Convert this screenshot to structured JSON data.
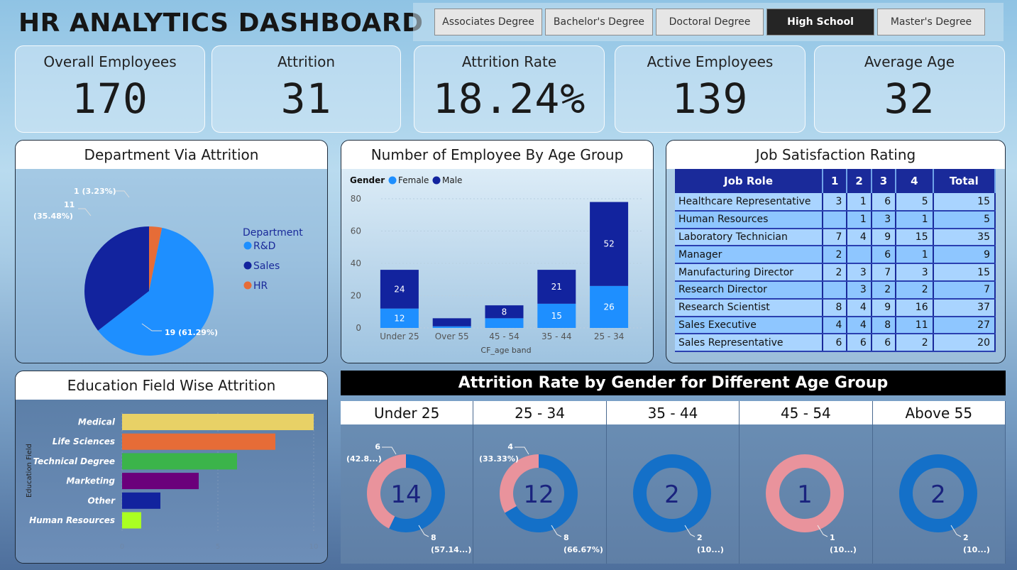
{
  "header": {
    "title": "HR ANALYTICS DASHBOARD"
  },
  "slicer": {
    "options": [
      "Associates Degree",
      "Bachelor's Degree",
      "Doctoral Degree",
      "High School",
      "Master's Degree"
    ],
    "selected": "High School"
  },
  "kpis": [
    {
      "label": "Overall Employees",
      "value": "170"
    },
    {
      "label": "Attrition",
      "value": "31"
    },
    {
      "label": "Attrition Rate",
      "value": "18.24%"
    },
    {
      "label": "Active Employees",
      "value": "139"
    },
    {
      "label": "Average Age",
      "value": "32"
    }
  ],
  "department_panel": {
    "title": "Department Via Attrition"
  },
  "age_panel": {
    "title": "Number of Employee By Age Group"
  },
  "job_panel": {
    "title": "Job Satisfaction Rating"
  },
  "edu_panel": {
    "title": "Education Field Wise Attrition"
  },
  "gender_panel": {
    "title": "Attrition Rate by Gender for Different Age Group"
  },
  "colors": {
    "rd": "#1e8fff",
    "sales": "#12239e",
    "hr": "#e66c37",
    "female": "#1e8fff",
    "male": "#12239e",
    "donut_blue": "#1470c8",
    "donut_pink": "#e9939c"
  },
  "chart_data": [
    {
      "type": "pie",
      "title": "Department Via Attrition",
      "legend_title": "Department",
      "legend_position": "right",
      "categories": [
        "R&D",
        "Sales",
        "HR"
      ],
      "values": [
        19,
        11,
        1
      ],
      "labels": [
        "19 (61.29%)",
        "11 (35.48%)",
        "1 (3.23%)"
      ]
    },
    {
      "type": "bar",
      "stacked": true,
      "title": "Number of Employee By Age Group",
      "legend_title": "Gender",
      "legend_position": "top-left",
      "xlabel": "CF_age band",
      "ylabel": "",
      "categories": [
        "Under 25",
        "Over 55",
        "45 - 54",
        "35 - 44",
        "25 - 34"
      ],
      "ylim": [
        0,
        80
      ],
      "yticks": [
        0,
        20,
        40,
        60,
        80
      ],
      "series": [
        {
          "name": "Female",
          "values": [
            12,
            1,
            6,
            15,
            26
          ],
          "labels": [
            "12",
            "",
            "",
            "15",
            "26"
          ]
        },
        {
          "name": "Male",
          "values": [
            24,
            5,
            8,
            21,
            52
          ],
          "labels": [
            "24",
            "",
            "8",
            "21",
            "52"
          ]
        }
      ]
    },
    {
      "type": "table",
      "title": "Job Satisfaction Rating",
      "columns": [
        "Job Role",
        "1",
        "2",
        "3",
        "4",
        "Total"
      ],
      "rows": [
        [
          "Healthcare Representative",
          "3",
          "1",
          "6",
          "5",
          "15"
        ],
        [
          "Human Resources",
          "",
          "1",
          "3",
          "1",
          "5"
        ],
        [
          "Laboratory Technician",
          "7",
          "4",
          "9",
          "15",
          "35"
        ],
        [
          "Manager",
          "2",
          "",
          "6",
          "1",
          "9"
        ],
        [
          "Manufacturing Director",
          "2",
          "3",
          "7",
          "3",
          "15"
        ],
        [
          "Research Director",
          "",
          "3",
          "2",
          "2",
          "7"
        ],
        [
          "Research Scientist",
          "8",
          "4",
          "9",
          "16",
          "37"
        ],
        [
          "Sales Executive",
          "4",
          "4",
          "8",
          "11",
          "27"
        ],
        [
          "Sales Representative",
          "6",
          "6",
          "6",
          "2",
          "20"
        ]
      ]
    },
    {
      "type": "bar",
      "orientation": "horizontal",
      "title": "Education Field Wise Attrition",
      "ylabel": "Education Field",
      "categories": [
        "Medical",
        "Life Sciences",
        "Technical Degree",
        "Marketing",
        "Other",
        "Human Resources"
      ],
      "values": [
        10,
        8,
        6,
        4,
        2,
        1
      ],
      "bar_colors": [
        "#e8d166",
        "#e66c37",
        "#3bb44a",
        "#6b007b",
        "#12239e",
        "#aaff22"
      ],
      "xlim": [
        0,
        10
      ],
      "xticks": [
        0,
        5,
        10
      ]
    },
    {
      "type": "pie",
      "donut": true,
      "title": "Attrition Rate by Gender for Different Age Group",
      "groups": [
        {
          "name": "Under 25",
          "center": "14",
          "values": [
            6,
            8
          ],
          "labels": [
            "6",
            "(42.8...)",
            "8",
            "(57.14...)"
          ]
        },
        {
          "name": "25 - 34",
          "center": "12",
          "values": [
            4,
            8
          ],
          "labels": [
            "4",
            "(33.33%)",
            "8",
            "(66.67%)"
          ]
        },
        {
          "name": "35 - 44",
          "center": "2",
          "values": [
            0,
            2
          ],
          "labels": [
            "",
            "",
            "2",
            "(10...)"
          ]
        },
        {
          "name": "45 - 54",
          "center": "1",
          "values": [
            1,
            0
          ],
          "labels": [
            "",
            "",
            "1",
            "(10...)"
          ]
        },
        {
          "name": "Above 55",
          "center": "2",
          "values": [
            0,
            2
          ],
          "labels": [
            "",
            "",
            "2",
            "(10...)"
          ]
        }
      ]
    }
  ]
}
